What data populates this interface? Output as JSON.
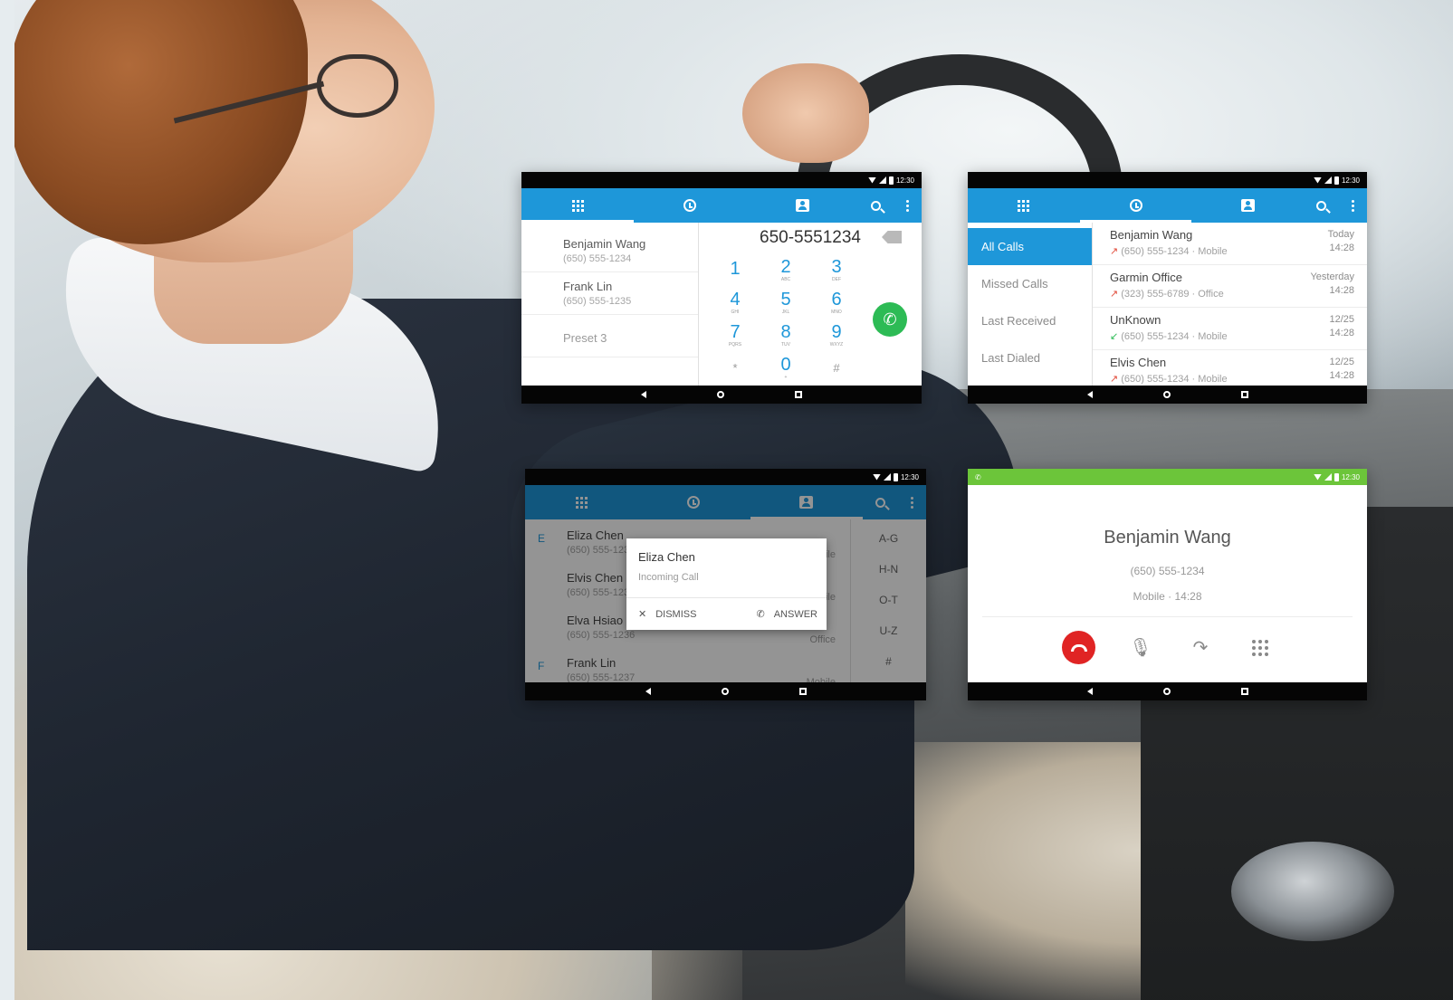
{
  "status_bar": {
    "time": "12:30"
  },
  "dialer": {
    "number": "650-5551234",
    "presets": [
      {
        "name": "Benjamin Wang",
        "phone": "(650) 555-1234"
      },
      {
        "name": "Frank Lin",
        "phone": "(650) 555-1235"
      },
      {
        "name": "Preset 3",
        "phone": ""
      }
    ],
    "keys": [
      {
        "digit": "1",
        "letters": ""
      },
      {
        "digit": "2",
        "letters": "ABC"
      },
      {
        "digit": "3",
        "letters": "DEF"
      },
      {
        "digit": "4",
        "letters": "GHI"
      },
      {
        "digit": "5",
        "letters": "JKL"
      },
      {
        "digit": "6",
        "letters": "MNO"
      },
      {
        "digit": "7",
        "letters": "PQRS"
      },
      {
        "digit": "8",
        "letters": "TUV"
      },
      {
        "digit": "9",
        "letters": "WXYZ"
      },
      {
        "digit": "*",
        "letters": ""
      },
      {
        "digit": "0",
        "letters": "+"
      },
      {
        "digit": "#",
        "letters": ""
      }
    ]
  },
  "call_log": {
    "filters": [
      "All Calls",
      "Missed Calls",
      "Last Received",
      "Last Dialed"
    ],
    "entries": [
      {
        "name": "Benjamin Wang",
        "detail": "(650) 555-1234 · Mobile",
        "day": "Today",
        "time": "14:28"
      },
      {
        "name": "Garmin Office",
        "detail": "(323) 555-6789 · Office",
        "day": "Yesterday",
        "time": "14:28"
      },
      {
        "name": "UnKnown",
        "detail": "(650) 555-1234 · Mobile",
        "day": "12/25",
        "time": "14:28"
      },
      {
        "name": "Elvis Chen",
        "detail": "(650) 555-1234 · Mobile",
        "day": "12/25",
        "time": "14:28"
      }
    ]
  },
  "contacts": {
    "rows": [
      {
        "letter": "E",
        "name": "Eliza Chen",
        "phone": "(650) 555-1234",
        "type": "Mobile"
      },
      {
        "letter": "",
        "name": "Elvis Chen",
        "phone": "(650) 555-1235",
        "type": "Mobile"
      },
      {
        "letter": "",
        "name": "Elva Hsiao",
        "phone": "(650) 555-1236",
        "type": "Office"
      },
      {
        "letter": "F",
        "name": "Frank Lin",
        "phone": "(650) 555-1237",
        "type": "Mobile"
      }
    ],
    "index": [
      "A-G",
      "H-N",
      "O-T",
      "U-Z",
      "#"
    ],
    "dialog": {
      "title": "Eliza Chen",
      "subtitle": "Incoming Call",
      "dismiss": "DISMISS",
      "answer": "ANSWER"
    }
  },
  "in_call": {
    "name": "Benjamin Wang",
    "phone": "(650) 555-1234",
    "meta": "Mobile · 14:28"
  }
}
